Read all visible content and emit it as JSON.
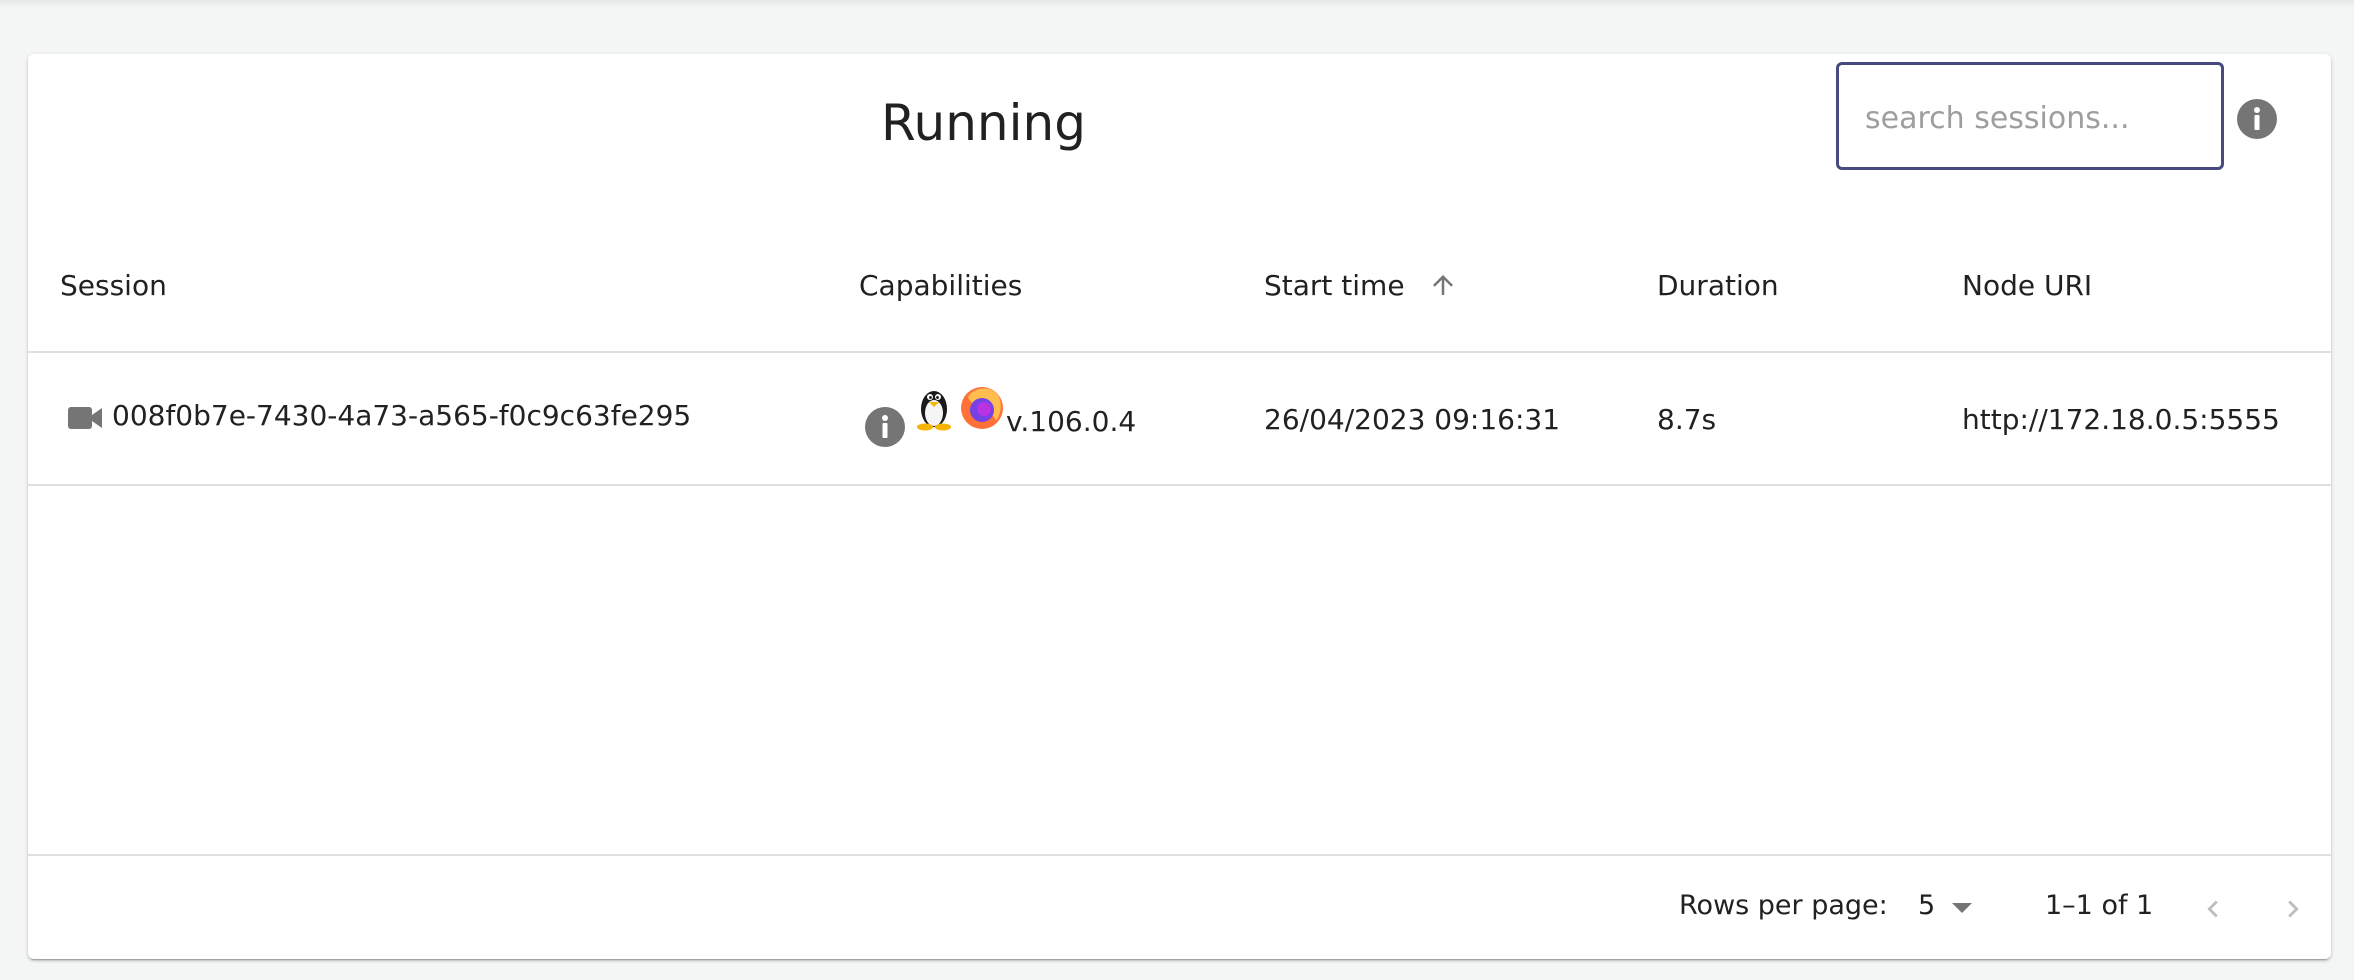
{
  "panel": {
    "title": "Running",
    "search_placeholder": "search sessions..."
  },
  "table": {
    "columns": [
      "Session",
      "Capabilities",
      "Start time",
      "Duration",
      "Node URI"
    ],
    "sort": {
      "column": "Start time",
      "direction": "ascending"
    },
    "rows": [
      {
        "session": "008f0b7e-7430-4a73-a565-f0c9c63fe295",
        "session_icon": "video-camera-icon",
        "capabilities": {
          "os_icon": "linux-tux-icon",
          "browser_icon": "firefox-icon",
          "version": "v.106.0.4"
        },
        "start_time": "26/04/2023 09:16:31",
        "duration": "8.7s",
        "node_uri": "http://172.18.0.5:5555"
      }
    ]
  },
  "pagination": {
    "rows_per_page_label": "Rows per page:",
    "rows_per_page_value": "5",
    "range_label": "1–1 of 1"
  },
  "colors": {
    "accent_border": "#4a4a82",
    "icon_gray": "#757575"
  }
}
